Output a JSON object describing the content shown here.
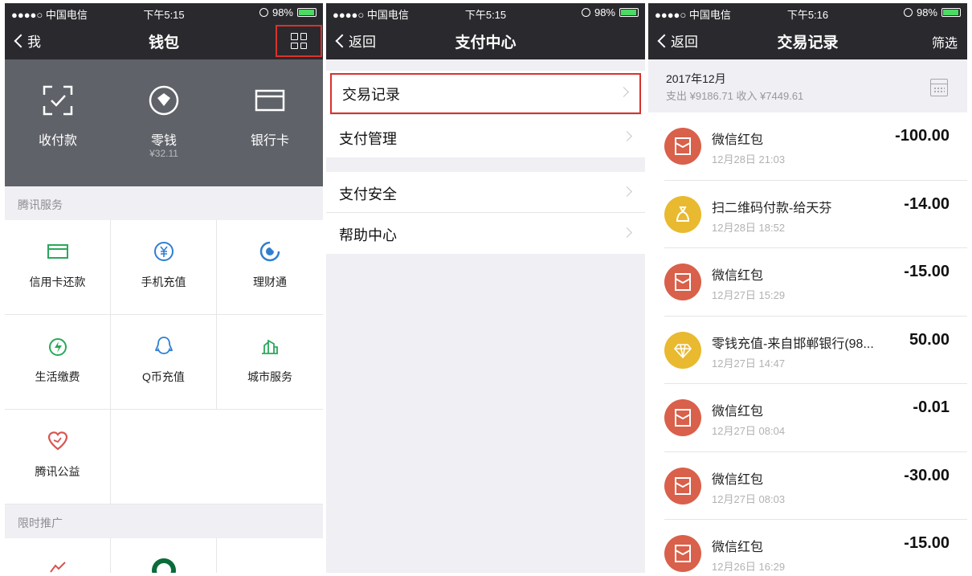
{
  "status": {
    "carrier": "●●●●○ 中国电信",
    "battery": "98%",
    "times": [
      "下午5:15",
      "下午5:15",
      "下午5:16"
    ]
  },
  "wallet": {
    "back_label": "我",
    "title": "钱包",
    "banner": [
      {
        "label": "收付款",
        "icon": "scan-pay-icon"
      },
      {
        "label": "零钱",
        "sub": "¥32.11",
        "icon": "balance-icon"
      },
      {
        "label": "银行卡",
        "icon": "card-icon"
      }
    ],
    "section_tencent": "腾讯服务",
    "services": [
      {
        "label": "信用卡还款",
        "icon": "credit-card-icon",
        "color": "#2aa85a"
      },
      {
        "label": "手机充值",
        "icon": "yuan-icon",
        "color": "#2f7fd1"
      },
      {
        "label": "理财通",
        "icon": "licaitong-icon",
        "color": "#2f7fd1"
      },
      {
        "label": "生活缴费",
        "icon": "utility-icon",
        "color": "#2aa85a"
      },
      {
        "label": "Q币充值",
        "icon": "qq-icon",
        "color": "#2f7fd1"
      },
      {
        "label": "城市服务",
        "icon": "city-icon",
        "color": "#2aa85a"
      },
      {
        "label": "腾讯公益",
        "icon": "charity-icon",
        "color": "#d9534f"
      }
    ],
    "section_promo": "限时推广"
  },
  "pay_center": {
    "back_label": "返回",
    "title": "支付中心",
    "items": [
      "交易记录",
      "支付管理",
      "支付安全",
      "帮助中心"
    ]
  },
  "records": {
    "back_label": "返回",
    "title": "交易记录",
    "filter_label": "筛选",
    "month": "2017年12月",
    "summary": "支出 ¥9186.71 收入 ¥7449.61",
    "transactions": [
      {
        "name": "微信红包",
        "time": "12月28日 21:03",
        "amount": "-100.00",
        "icon": "red-packet-icon",
        "color": "#d9604a"
      },
      {
        "name": "扫二维码付款-给天芬",
        "time": "12月28日 18:52",
        "amount": "-14.00",
        "icon": "money-bag-icon",
        "color": "#e9b92f"
      },
      {
        "name": "微信红包",
        "time": "12月27日 15:29",
        "amount": "-15.00",
        "icon": "red-packet-icon",
        "color": "#d9604a"
      },
      {
        "name": "零钱充值-来自邯郸银行(98...",
        "time": "12月27日 14:47",
        "amount": "50.00",
        "icon": "diamond-icon",
        "color": "#e9b92f"
      },
      {
        "name": "微信红包",
        "time": "12月27日 08:04",
        "amount": "-0.01",
        "icon": "red-packet-icon",
        "color": "#d9604a"
      },
      {
        "name": "微信红包",
        "time": "12月27日 08:03",
        "amount": "-30.00",
        "icon": "red-packet-icon",
        "color": "#d9604a"
      },
      {
        "name": "微信红包",
        "time": "12月26日 16:29",
        "amount": "-15.00",
        "icon": "red-packet-icon",
        "color": "#d9604a"
      }
    ]
  }
}
